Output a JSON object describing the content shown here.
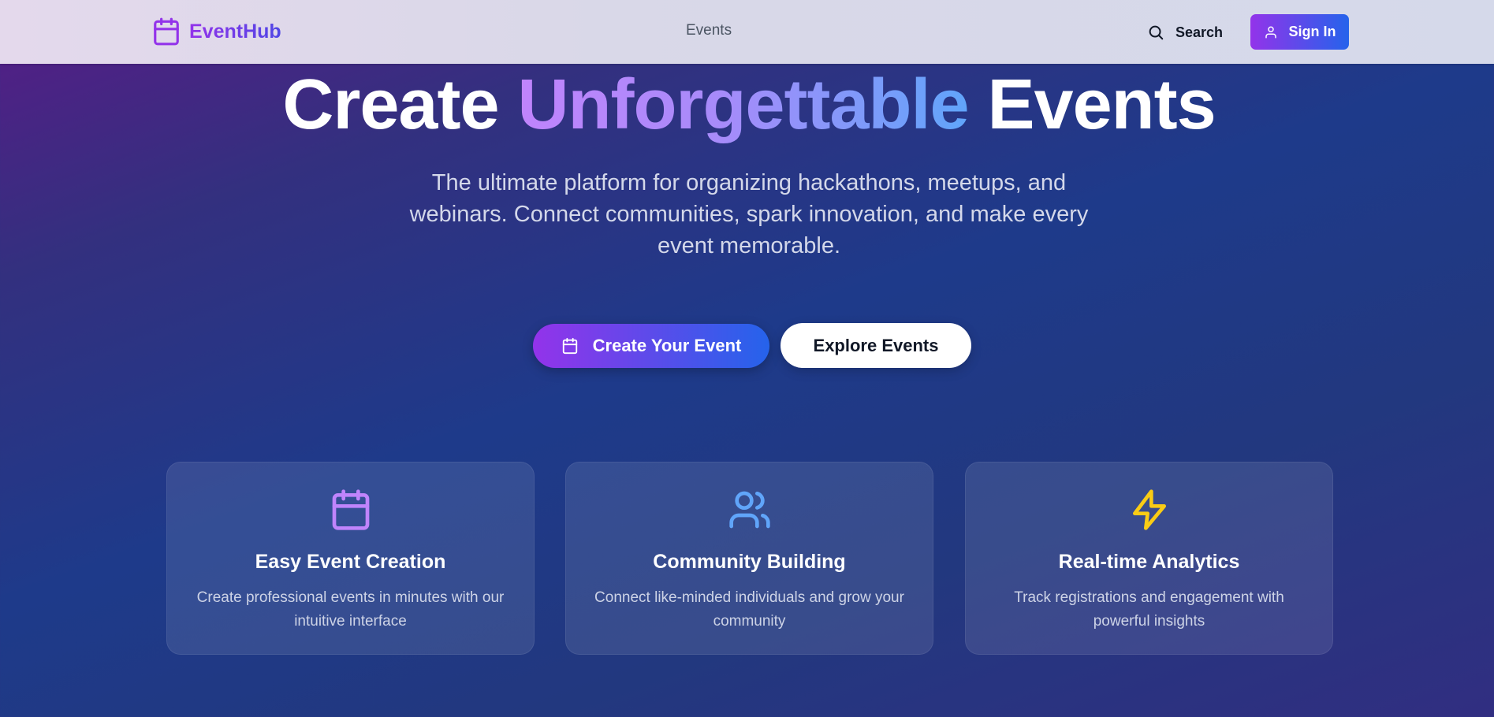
{
  "header": {
    "brand": "EventHub",
    "nav_events": "Events",
    "search_label": "Search",
    "signin_label": "Sign In"
  },
  "hero": {
    "title_before": "Create ",
    "title_highlight": "Unforgettable",
    "title_after": " Events",
    "subtitle": "The ultimate platform for organizing hackathons, meetups, and webinars. Connect communities, spark innovation, and make every event memorable.",
    "primary_cta": "Create Your Event",
    "secondary_cta": "Explore Events"
  },
  "features": [
    {
      "icon": "calendar-icon",
      "title": "Easy Event Creation",
      "description": "Create professional events in minutes with our intuitive interface",
      "icon_color": "#c084fc"
    },
    {
      "icon": "users-icon",
      "title": "Community Building",
      "description": "Connect like-minded individuals and grow your community",
      "icon_color": "#60a5fa"
    },
    {
      "icon": "zap-icon",
      "title": "Real-time Analytics",
      "description": "Track registrations and engagement with powerful insights",
      "icon_color": "#facc15"
    }
  ],
  "colors": {
    "brand_purple": "#9333ea",
    "brand_blue": "#2563eb",
    "background_start": "#581c87",
    "background_mid": "#1e3a8a"
  }
}
